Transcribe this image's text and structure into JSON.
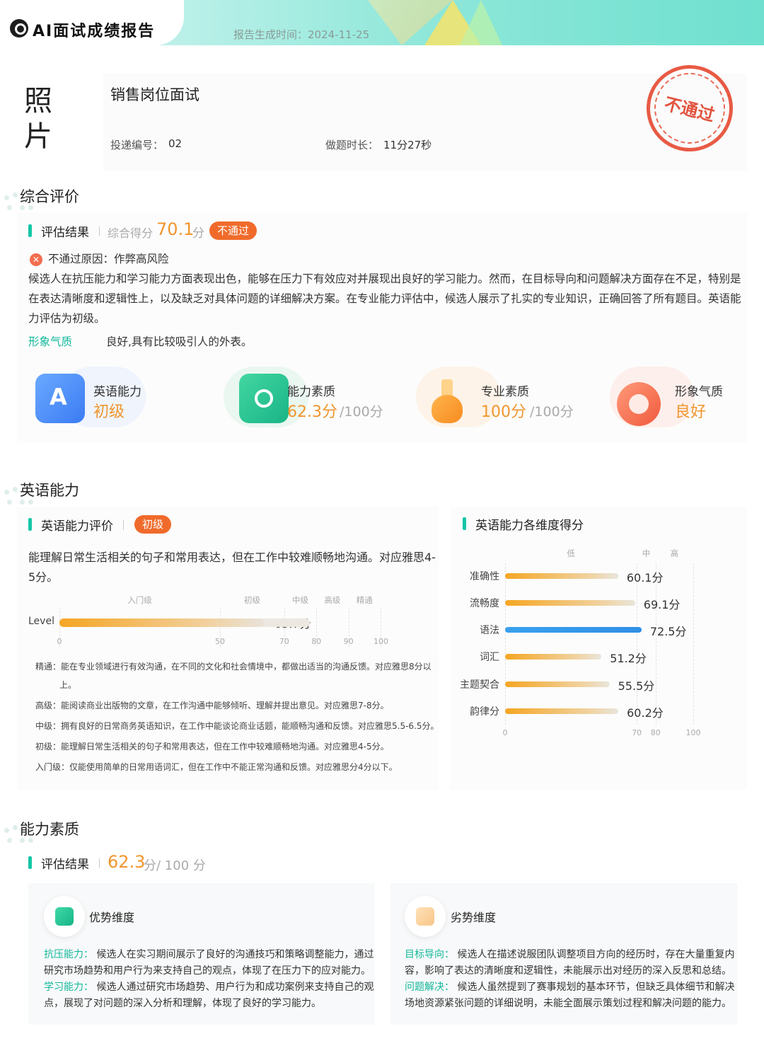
{
  "header": {
    "brand": "AI面试成绩报告",
    "generated_label": "报告生成时间：2024-11-25"
  },
  "profile": {
    "photo_label": "照片",
    "job_title": "销售岗位面试",
    "delivery_label": "投递编号：",
    "delivery_value": "02",
    "duration_label": "做题时长：",
    "duration_value": "11分27秒",
    "stamp_text": "不通过"
  },
  "overall": {
    "section_title": "综合评价",
    "result_label": "评估结果",
    "score_label": "综合得分",
    "score": "70.1",
    "score_unit": "分",
    "status_badge": "不通过",
    "fail_reason": "不通过原因：作弊高风险",
    "summary_line1": "候选人在抗压能力和学习能力方面表现出色，能够在压力下有效应对并展现出良好的学习能力。然而，在目标导向和问题解决方面存在不足，特别是",
    "summary_line2": "在表达清晰度和逻辑性上，以及缺乏对具体问题的详细解决方案。在专业能力评估中，候选人展示了扎实的专业知识，正确回答了所有题目。英语能",
    "summary_line3": "力评估为初级。",
    "appearance_label": "形象气质",
    "appearance_value": "良好,具有比较吸引人的外表。",
    "cards": [
      {
        "label": "英语能力",
        "value": "初级",
        "unit": "",
        "color": "#f0962e",
        "icon": "english-icon"
      },
      {
        "label": "能力素质",
        "value": "62.3分",
        "unit": "/100分",
        "color": "#f0962e",
        "icon": "ability-icon"
      },
      {
        "label": "专业素质",
        "value": "100分",
        "unit": "/100分",
        "color": "#f0962e",
        "icon": "flask-icon"
      },
      {
        "label": "形象气质",
        "value": "良好",
        "unit": "",
        "color": "#f0962e",
        "icon": "appearance-icon"
      }
    ]
  },
  "english": {
    "section_title": "英语能力",
    "eval_label": "英语能力评价",
    "level_badge": "初级",
    "desc_line1": "能理解日常生活相关的句子和常用表达，但在工作中较难顺畅地沟通。对应雅思4-",
    "desc_line2": "5分。",
    "level_chart_label": "Level",
    "level_bands": [
      "入门级",
      "初级",
      "中级",
      "高级",
      "精通"
    ],
    "level_value_text": "63.7分",
    "legend": [
      {
        "name": "精通",
        "text": "精通：能在专业领域进行有效沟通，在不同的文化和社会情境中，都做出适当的沟通反馈。对应雅思8分以"
      },
      {
        "name": "精通-cont",
        "text": "上。"
      },
      {
        "name": "高级",
        "text": "高级：能阅读商业出版物的文章，在工作沟通中能够倾听、理解并提出意见。对应雅思7-8分。"
      },
      {
        "name": "中级",
        "text": "中级：拥有良好的日常商务英语知识，在工作中能谈论商业话题，能顺畅沟通和反馈。对应雅思5.5-6.5分。"
      },
      {
        "name": "初级",
        "text": "初级：能理解日常生活相关的句子和常用表达，但在工作中较难顺畅地沟通。对应雅思4-5分。"
      },
      {
        "name": "入门级",
        "text": "入门级：仅能使用简单的日常用语词汇，但在工作中不能正常沟通和反馈。对应雅思分4分以下。"
      }
    ],
    "dims_title": "英语能力各维度得分",
    "dims_band_labels": [
      "低",
      "中",
      "高"
    ],
    "dims_value_texts": [
      "60.1分",
      "69.1分",
      "72.5分",
      "51.2分",
      "55.5分",
      "60.2分"
    ]
  },
  "competency": {
    "section_title": "能力素质",
    "result_label": "评估结果",
    "score": "62.3",
    "score_unit": "分/ 100 分",
    "strength_title": "优势维度",
    "weakness_title": "劣势维度",
    "strength_lines": [
      {
        "head": "抗压能力：",
        "text": "候选人在实习期间展示了良好的沟通技巧和策略调整能力，通过"
      },
      {
        "head": "",
        "text": "研究市场趋势和用户行为来支持自己的观点，体现了在压力下的应对能力。"
      },
      {
        "head": "学习能力：",
        "text": "候选人通过研究市场趋势、用户行为和成功案例来支持自己的观"
      },
      {
        "head": "",
        "text": "点，展现了对问题的深入分析和理解，体现了良好的学习能力。"
      }
    ],
    "weakness_lines": [
      {
        "head": "目标导向：",
        "text": "候选人在描述说服团队调整项目方向的经历时，存在大量重复内"
      },
      {
        "head": "",
        "text": "容，影响了表达的清晰度和逻辑性，未能展示出对经历的深入反思和总结。"
      },
      {
        "head": "问题解决：",
        "text": "候选人虽然提到了赛事规划的基本环节，但缺乏具体细节和解决"
      },
      {
        "head": "",
        "text": "场地资源紧张问题的详细说明，未能全面展示策划过程和解决问题的能力。"
      }
    ]
  },
  "chart_data": [
    {
      "type": "bar",
      "orientation": "horizontal",
      "categories": [
        "Level"
      ],
      "values": [
        63.7
      ],
      "xlim": [
        0,
        100
      ],
      "xticks": [
        0,
        50,
        70,
        80,
        90,
        100
      ],
      "bands": [
        "入门级",
        "初级",
        "中级",
        "高级",
        "精通"
      ],
      "colors": {
        "bar": "#f5a623"
      }
    },
    {
      "type": "bar",
      "orientation": "horizontal",
      "title": "英语能力各维度得分",
      "categories": [
        "准确性",
        "流畅度",
        "语法",
        "词汇",
        "主题契合",
        "韵律分"
      ],
      "values": [
        60.1,
        69.1,
        72.5,
        51.2,
        55.5,
        60.2
      ],
      "xlim": [
        0,
        100
      ],
      "xticks": [
        0,
        70,
        80,
        100
      ],
      "bands": [
        "低",
        "中",
        "高"
      ],
      "colors": {
        "bar": "#f5a623",
        "highlight": "#3aa1ee"
      },
      "highlight_index": 2
    }
  ]
}
